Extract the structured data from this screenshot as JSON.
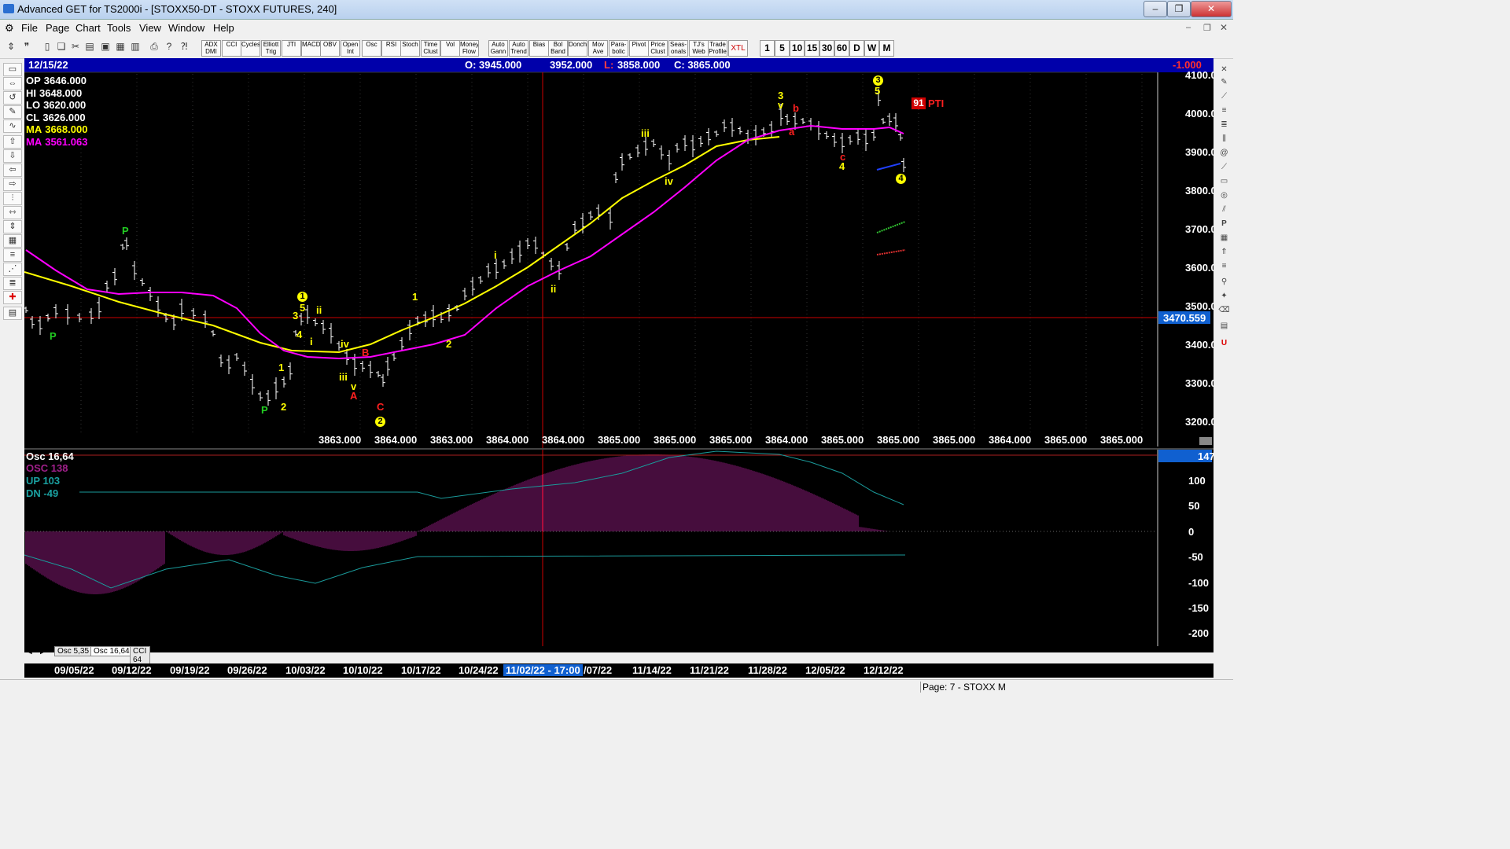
{
  "window": {
    "title": "Advanced GET for TS2000i - [STOXX50-DT - STOXX FUTURES, 240]",
    "min": "–",
    "max": "❐",
    "close": "✕"
  },
  "menu": [
    {
      "label": "File"
    },
    {
      "label": "Page"
    },
    {
      "label": "Chart"
    },
    {
      "label": "Tools"
    },
    {
      "label": "View"
    },
    {
      "label": "Window"
    },
    {
      "label": "Help"
    }
  ],
  "toolbar_buttons": [
    "ADX DMI",
    "CCI",
    "Cycles",
    "Elliott Trig",
    "JTI",
    "MACD",
    "OBV",
    "Open Int",
    "Osc",
    "RSI",
    "Stoch",
    "Time Clust",
    "Vol",
    "Money Flow",
    "Auto Gann",
    "Auto Trend",
    "Bias",
    "Bol Band",
    "Donch",
    "Mov Ave",
    "Para- bolic",
    "Pivot",
    "Price Clust",
    "Seas- onals",
    "TJ's Web",
    "Trade Profile",
    "XTL"
  ],
  "interval_buttons": [
    "1",
    "5",
    "10",
    "15",
    "30",
    "60",
    "D",
    "W",
    "M"
  ],
  "header": {
    "date": "12/15/22",
    "open": "O: 3945.000",
    "high": "3952.000",
    "low_label": "L:",
    "low": "3858.000",
    "close": "C: 3865.000",
    "change": "-1.000"
  },
  "indicators": [
    {
      "label": "OP",
      "value": "3646.000",
      "color": "#ffffff"
    },
    {
      "label": "HI",
      "value": "3648.000",
      "color": "#ffffff"
    },
    {
      "label": "LO",
      "value": "3620.000",
      "color": "#ffffff"
    },
    {
      "label": "CL",
      "value": "3626.000",
      "color": "#ffffff"
    },
    {
      "label": "MA",
      "value": "3668.000",
      "color": "#ffff00"
    },
    {
      "label": "MA",
      "value": "3561.063",
      "color": "#ff00ff"
    }
  ],
  "price_axis": [
    "4100.000",
    "4000.000",
    "3900.000",
    "3800.000",
    "3700.000",
    "3600.000",
    "3500.000",
    "3400.000",
    "3300.000",
    "3200.000"
  ],
  "crosshair_price": "3470.559",
  "pti": {
    "value": "91",
    "label": "PTI"
  },
  "bottom_values": [
    "3863.000",
    "3864.000",
    "3863.000",
    "3864.000",
    "3864.000",
    "3865.000",
    "3865.000",
    "3865.000",
    "3864.000",
    "3865.000",
    "3865.000",
    "3865.000",
    "3864.000",
    "3865.000",
    "3865.000"
  ],
  "osc": {
    "title": "Osc 16,64",
    "osc_label": "OSC",
    "osc_value": "138",
    "up_label": "UP",
    "up_value": "103",
    "dn_label": "DN",
    "dn_value": "-49",
    "top_value": "147",
    "axis": [
      "100",
      "50",
      "0",
      "-50",
      "-100",
      "-150",
      "-200"
    ]
  },
  "tabs": [
    "Osc 5,35",
    "Osc 16,64",
    "CCI 64"
  ],
  "dates": [
    "09/05/22",
    "09/12/22",
    "09/19/22",
    "09/26/22",
    "10/03/22",
    "10/10/22",
    "10/17/22",
    "10/24/22",
    "11/02/22 - 17:00",
    "/07/22",
    "11/14/22",
    "11/21/22",
    "11/28/22",
    "12/05/22",
    "12/12/22"
  ],
  "status": "Page: 7 - STOXX M",
  "colors": {
    "ma_fast": "#ffff00",
    "ma_slow": "#ff00ff",
    "crosshair": "#cc0000",
    "osc_hist": "#8b1a7a",
    "osc_line": "#1a9a9a"
  }
}
